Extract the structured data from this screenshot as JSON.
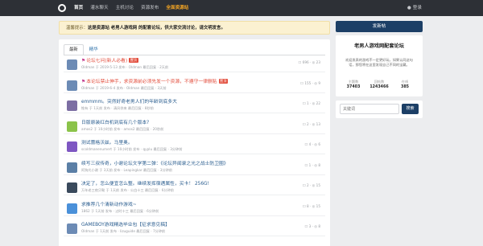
{
  "topbar": {
    "nav": [
      "首页",
      "灌水聊天",
      "主机讨论",
      "资源发布",
      "全面资源站"
    ],
    "login": "登录"
  },
  "notice": {
    "label": "温馨提示：",
    "text": "这是资源站 老男人游戏网 的配套论坛，供大家交流讨论，请文明发言。"
  },
  "tabs": [
    "最新",
    "精华"
  ],
  "threads": [
    {
      "title": "论坛七问(新人必看)",
      "badge": "置顶",
      "flag": true,
      "red": true,
      "meta": "Oldman 于 2019-5-13 发布 · Oldman 最后回复 · 2天前",
      "stats": "☐ 696 · ◎ 23",
      "avatar": "#6c8bb5"
    },
    {
      "title": "本论坛禁止伸手，求资源前必须先发一个资源，不遵守一律删贴",
      "badge": "置顶",
      "flag": true,
      "red": true,
      "meta": "Oldman 于 2019-6-4 发布 · Oldman 最后回复 · 3天前",
      "stats": "☐ 155 · ◎ 9",
      "avatar": "#6c8bb5"
    },
    {
      "title": "emmmm。突然好奇老男人们的年龄到底多大",
      "badge": "",
      "flag": false,
      "red": false,
      "meta": "惟有 于 1天前 发布 · 清风徐来 最后回复 · 8秒前",
      "stats": "☐ 1 · ◎ 22",
      "avatar": "#7c6ea3"
    },
    {
      "title": "日版原装红白机到底有几个版本?",
      "badge": "",
      "flag": false,
      "red": false,
      "meta": "amos2 于 10小时前 发布 · amos2 最后回复 · 20秒前",
      "stats": "☐ 2 · ◎ 13",
      "avatar": "#8bc34a"
    },
    {
      "title": "测试蕾格沃兹。马里奥。",
      "badge": "",
      "flag": false,
      "red": false,
      "meta": "scoldmanenumert 于 10小时前 发布 · qyplu 最后回复 · 3分钟前",
      "stats": "☐ 4 · ◎ 6",
      "avatar": "#7e57c2"
    },
    {
      "title": "续写三叔传奇，小谢论坛文学第二弹：《论坛异闻录之光之战士防卫圈》",
      "badge": "",
      "flag": false,
      "red": false,
      "meta": "阿狗光小谢 于 3天前 发布 · Leapingkar 最后回复 · 3分钟前",
      "stats": "☐ 1 · ◎ 8",
      "avatar": "#5b7fa6"
    },
    {
      "title": "决定了，怎么便宜怎么整。继续发挥宿遇属性，买卡！ 256G!",
      "badge": "",
      "flag": false,
      "red": false,
      "meta": "万年老三夜贝勒 于 1天前 发布 · 公白十三 最后回复 · 6分钟前",
      "stats": "☐ 2 · ◎ 15",
      "avatar": "#3a4a5c"
    },
    {
      "title": "求推荐几个清新动作游戏~",
      "badge": "",
      "flag": false,
      "red": false,
      "meta": "1862 于 1天前 发布 · 过时十三 最后回复 · 6分钟前",
      "stats": "☐ 8 · ◎ 15",
      "avatar": "#4a90d9"
    },
    {
      "title": "GAMEBOY游戏精选毕业包【征求意见稿】",
      "badge": "",
      "flag": false,
      "red": false,
      "meta": "Oldman 于 1天前 发布 · lizuguide 最后回复 · 7分钟前",
      "stats": "☐ 3 · ◎ 8",
      "avatar": "#6c8bb5"
    }
  ],
  "sidebar": {
    "post_button": "发新帖",
    "card_title": "老男人游戏网配套论坛",
    "card_desc": "欢迎发表的游戏不一定更好玩，如果认同这句话，那您将在这里发现自己不同的宝藏。",
    "stats": [
      {
        "label": "主题数",
        "value": "37403"
      },
      {
        "label": "回帖数",
        "value": "1243466"
      },
      {
        "label": "在线",
        "value": "385"
      }
    ],
    "search_placeholder": "关键词",
    "search_button": "搜索"
  },
  "colors": {
    "topbar": "#2d3036",
    "accent": "#1c3f66",
    "sticky": "#e24c3b",
    "link": "#2a5d8f"
  }
}
